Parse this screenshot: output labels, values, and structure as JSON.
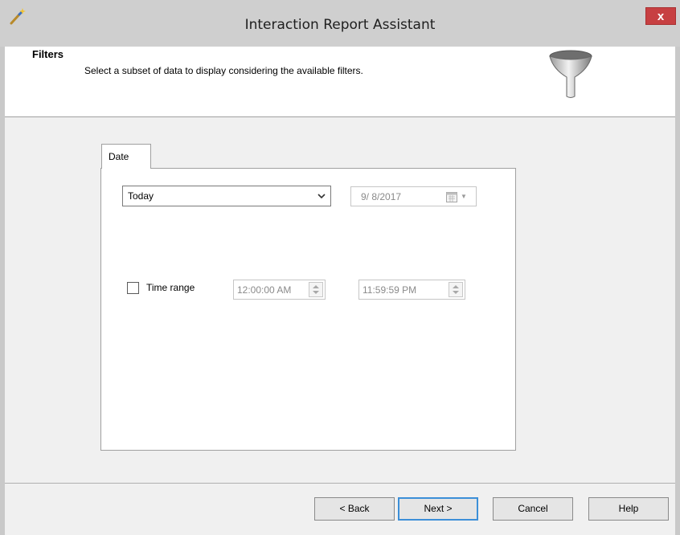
{
  "window": {
    "title": "Interaction Report Assistant",
    "close_label": "x"
  },
  "header": {
    "title": "Filters",
    "description": "Select a subset of data to display considering the available filters."
  },
  "tabs": [
    {
      "label": "Date",
      "selected": true
    }
  ],
  "date_filter": {
    "range_value": "Today",
    "date_value": "9/ 8/2017",
    "date_enabled": false
  },
  "time_range": {
    "checkbox_label": "Time range",
    "checked": false,
    "start_value": "12:00:00 AM",
    "end_value": "11:59:59 PM",
    "enabled": false
  },
  "buttons": {
    "back": "< Back",
    "next": "Next >",
    "cancel": "Cancel",
    "help": "Help"
  },
  "colors": {
    "close_button": "#c74042",
    "default_button_border": "#3c8fd8"
  },
  "icons": {
    "app": "wand-icon",
    "header": "funnel-icon",
    "calendar": "calendar-icon"
  }
}
